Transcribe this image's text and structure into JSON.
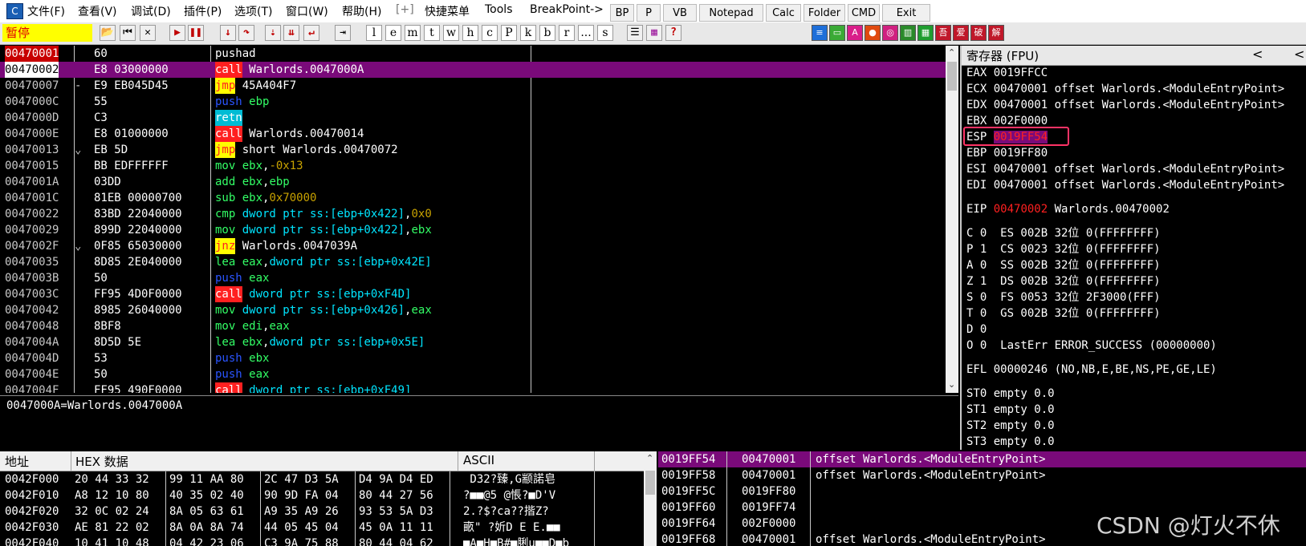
{
  "menu": {
    "app_icon": "C",
    "items": [
      "文件(F)",
      "查看(V)",
      "调试(D)",
      "插件(P)",
      "选项(T)",
      "窗口(W)",
      "帮助(H)",
      "[+]",
      "快捷菜单",
      "Tools",
      "BreakPoint->"
    ],
    "buttons": [
      "BP",
      "P",
      "VB",
      "Notepad",
      "Calc",
      "Folder",
      "CMD",
      "Exit"
    ]
  },
  "toolbar": {
    "state": "暂停",
    "letters": [
      "l",
      "e",
      "m",
      "t",
      "w",
      "h",
      "c",
      "P",
      "k",
      "b",
      "r",
      "...",
      "s"
    ],
    "colored_icons": [
      "≡",
      "▭",
      "A",
      "●",
      "◎",
      "▥",
      "▦",
      "吾",
      "爱",
      "破",
      "解"
    ]
  },
  "colors": {
    "accent_select": "#7a0a7a",
    "highlight_box": "#ff3366"
  },
  "disasm": {
    "rows": [
      {
        "addr": "00470001",
        "marker": "",
        "bytes": "60",
        "mn": "pushad",
        "mnc": "c-white",
        "mnbg": "",
        "ops": []
      },
      {
        "addr": "00470002",
        "marker": "",
        "bytes": "E8 03000000",
        "mn": "call",
        "mnc": "c-white",
        "mnbg": "#ff2020",
        "ops": [
          {
            "t": " Warlords.0047000A",
            "c": "c-white"
          }
        ]
      },
      {
        "addr": "00470007",
        "marker": "-",
        "bytes": "E9 EB045D45",
        "mn": "jmp",
        "mnc": "c-red",
        "mnbg": "#ffff00",
        "ops": [
          {
            "t": " 45A404F7",
            "c": "c-white"
          }
        ]
      },
      {
        "addr": "0047000C",
        "marker": "",
        "bytes": "55",
        "mn": "push",
        "mnc": "c-blue",
        "mnbg": "",
        "ops": [
          {
            "t": " ebp",
            "c": "c-green"
          }
        ]
      },
      {
        "addr": "0047000D",
        "marker": "",
        "bytes": "C3",
        "mn": "retn",
        "mnc": "c-white",
        "mnbg": "#00bcd4",
        "ops": []
      },
      {
        "addr": "0047000E",
        "marker": "",
        "bytes": "E8 01000000",
        "mn": "call",
        "mnc": "c-white",
        "mnbg": "#ff2020",
        "ops": [
          {
            "t": " Warlords.00470014",
            "c": "c-white"
          }
        ]
      },
      {
        "addr": "00470013",
        "marker": "⌄",
        "bytes": "EB 5D",
        "mn": "jmp",
        "mnc": "c-red",
        "mnbg": "#ffff00",
        "ops": [
          {
            "t": " short Warlords.00470072",
            "c": "c-white"
          }
        ]
      },
      {
        "addr": "00470015",
        "marker": "",
        "bytes": "BB EDFFFFFF",
        "mn": "mov",
        "mnc": "c-green",
        "mnbg": "",
        "ops": [
          {
            "t": " ebx",
            "c": "c-green"
          },
          {
            "t": ",",
            "c": "c-white"
          },
          {
            "t": "-0x13",
            "c": "c-olive"
          }
        ]
      },
      {
        "addr": "0047001A",
        "marker": "",
        "bytes": "03DD",
        "mn": "add",
        "mnc": "c-green",
        "mnbg": "",
        "ops": [
          {
            "t": " ebx",
            "c": "c-green"
          },
          {
            "t": ",",
            "c": "c-white"
          },
          {
            "t": "ebp",
            "c": "c-green"
          }
        ]
      },
      {
        "addr": "0047001C",
        "marker": "",
        "bytes": "81EB 00000700",
        "mn": "sub",
        "mnc": "c-green",
        "mnbg": "",
        "ops": [
          {
            "t": " ebx",
            "c": "c-green"
          },
          {
            "t": ",",
            "c": "c-white"
          },
          {
            "t": "0x70000",
            "c": "c-olive"
          }
        ]
      },
      {
        "addr": "00470022",
        "marker": "",
        "bytes": "83BD 22040000",
        "mn": "cmp",
        "mnc": "c-green",
        "mnbg": "",
        "ops": [
          {
            "t": " dword ptr ss:[ebp+0x422]",
            "c": "c-cyan"
          },
          {
            "t": ",",
            "c": "c-white"
          },
          {
            "t": "0x0",
            "c": "c-olive"
          }
        ]
      },
      {
        "addr": "00470029",
        "marker": "",
        "bytes": "899D 22040000",
        "mn": "mov",
        "mnc": "c-green",
        "mnbg": "",
        "ops": [
          {
            "t": " dword ptr ss:[ebp+0x422]",
            "c": "c-cyan"
          },
          {
            "t": ",",
            "c": "c-white"
          },
          {
            "t": "ebx",
            "c": "c-green"
          }
        ]
      },
      {
        "addr": "0047002F",
        "marker": "⌄",
        "bytes": "0F85 65030000",
        "mn": "jnz",
        "mnc": "c-red",
        "mnbg": "#ffff00",
        "ops": [
          {
            "t": " Warlords.0047039A",
            "c": "c-white"
          }
        ]
      },
      {
        "addr": "00470035",
        "marker": "",
        "bytes": "8D85 2E040000",
        "mn": "lea",
        "mnc": "c-green",
        "mnbg": "",
        "ops": [
          {
            "t": " eax",
            "c": "c-green"
          },
          {
            "t": ",",
            "c": "c-white"
          },
          {
            "t": "dword ptr ss:[ebp+0x42E]",
            "c": "c-cyan"
          }
        ]
      },
      {
        "addr": "0047003B",
        "marker": "",
        "bytes": "50",
        "mn": "push",
        "mnc": "c-blue",
        "mnbg": "",
        "ops": [
          {
            "t": " eax",
            "c": "c-green"
          }
        ]
      },
      {
        "addr": "0047003C",
        "marker": "",
        "bytes": "FF95 4D0F0000",
        "mn": "call",
        "mnc": "c-white",
        "mnbg": "#ff2020",
        "ops": [
          {
            "t": " dword ptr ss:[ebp+0xF4D]",
            "c": "c-cyan"
          }
        ]
      },
      {
        "addr": "00470042",
        "marker": "",
        "bytes": "8985 26040000",
        "mn": "mov",
        "mnc": "c-green",
        "mnbg": "",
        "ops": [
          {
            "t": " dword ptr ss:[ebp+0x426]",
            "c": "c-cyan"
          },
          {
            "t": ",",
            "c": "c-white"
          },
          {
            "t": "eax",
            "c": "c-green"
          }
        ]
      },
      {
        "addr": "00470048",
        "marker": "",
        "bytes": "8BF8",
        "mn": "mov",
        "mnc": "c-green",
        "mnbg": "",
        "ops": [
          {
            "t": " edi",
            "c": "c-green"
          },
          {
            "t": ",",
            "c": "c-white"
          },
          {
            "t": "eax",
            "c": "c-green"
          }
        ]
      },
      {
        "addr": "0047004A",
        "marker": "",
        "bytes": "8D5D 5E",
        "mn": "lea",
        "mnc": "c-green",
        "mnbg": "",
        "ops": [
          {
            "t": " ebx",
            "c": "c-green"
          },
          {
            "t": ",",
            "c": "c-white"
          },
          {
            "t": "dword ptr ss:[ebp+0x5E]",
            "c": "c-cyan"
          }
        ]
      },
      {
        "addr": "0047004D",
        "marker": "",
        "bytes": "53",
        "mn": "push",
        "mnc": "c-blue",
        "mnbg": "",
        "ops": [
          {
            "t": " ebx",
            "c": "c-green"
          }
        ]
      },
      {
        "addr": "0047004E",
        "marker": "",
        "bytes": "50",
        "mn": "push",
        "mnc": "c-blue",
        "mnbg": "",
        "ops": [
          {
            "t": " eax",
            "c": "c-green"
          }
        ]
      },
      {
        "addr": "0047004F",
        "marker": "",
        "bytes": "FF95 490F0000",
        "mn": "call",
        "mnc": "c-white",
        "mnbg": "#ff2020",
        "ops": [
          {
            "t": " dword ptr ss:[ebp+0xF49]",
            "c": "c-cyan"
          }
        ]
      }
    ]
  },
  "info": {
    "text": "0047000A=Warlords.0047000A"
  },
  "registers": {
    "title": "寄存器 (FPU)",
    "arrow": "<",
    "lines": [
      {
        "name": "EAX",
        "val": "0019FFCC",
        "rest": ""
      },
      {
        "name": "ECX",
        "val": "00470001",
        "rest": "offset Warlords.<ModuleEntryPoint>"
      },
      {
        "name": "EDX",
        "val": "00470001",
        "rest": "offset Warlords.<ModuleEntryPoint>"
      },
      {
        "name": "EBX",
        "val": "002F0000",
        "rest": ""
      },
      {
        "name": "ESP",
        "val": "0019FF54",
        "rest": ""
      },
      {
        "name": "EBP",
        "val": "0019FF80",
        "rest": ""
      },
      {
        "name": "ESI",
        "val": "00470001",
        "rest": "offset Warlords.<ModuleEntryPoint>"
      },
      {
        "name": "EDI",
        "val": "00470001",
        "rest": "offset Warlords.<ModuleEntryPoint>"
      },
      {
        "name": "EIP",
        "val": "00470002",
        "rest": "Warlords.00470002"
      }
    ],
    "flags": [
      "C 0  ES 002B 32位 0(FFFFFFFF)",
      "P 1  CS 0023 32位 0(FFFFFFFF)",
      "A 0  SS 002B 32位 0(FFFFFFFF)",
      "Z 1  DS 002B 32位 0(FFFFFFFF)",
      "S 0  FS 0053 32位 2F3000(FFF)",
      "T 0  GS 002B 32位 0(FFFFFFFF)",
      "D 0",
      "O 0  LastErr ERROR_SUCCESS (00000000)"
    ],
    "efl": "EFL 00000246 (NO,NB,E,BE,NS,PE,GE,LE)",
    "fpu": [
      "ST0 empty 0.0",
      "ST1 empty 0.0",
      "ST2 empty 0.0",
      "ST3 empty 0.0"
    ]
  },
  "dump": {
    "headers": [
      "地址",
      "HEX 数据",
      "ASCII"
    ],
    "rows": [
      {
        "addr": "0042F000",
        "hex": [
          "20 44 33 32",
          "99 11 AA 80",
          "2C 47 D3 5A",
          "D4 9A D4 ED"
        ],
        "ascii": " D32?臻,G颛諾皂"
      },
      {
        "addr": "0042F010",
        "hex": [
          "A8 12 10 80",
          "40 35 02 40",
          "90 9D FA 04",
          "80 44 27 56"
        ],
        "ascii": "?■■@5 @悵?■D'V"
      },
      {
        "addr": "0042F020",
        "hex": [
          "32 0C 02 24",
          "8A 05 63 61",
          "A9 35 A9 26",
          "93 53 5A D3"
        ],
        "ascii": "2.?$?ca??揩Z?"
      },
      {
        "addr": "0042F030",
        "hex": [
          "AE 81 22 02",
          "8A 0A 8A 74",
          "44 05 45 04",
          "45 0A 11 11"
        ],
        "ascii": "畞\" ?妡D E E.■■"
      },
      {
        "addr": "0042F040",
        "hex": [
          "10 41 10 48",
          "04 42 23 06",
          "C3 9A 75 88",
          "80 44 04 62"
        ],
        "ascii": "■A■H■B#■脷u■■D■b"
      }
    ]
  },
  "stack": {
    "rows": [
      {
        "addr": "0019FF54",
        "val": "00470001",
        "comment": "offset Warlords.<ModuleEntryPoint>"
      },
      {
        "addr": "0019FF58",
        "val": "00470001",
        "comment": "offset Warlords.<ModuleEntryPoint>"
      },
      {
        "addr": "0019FF5C",
        "val": "0019FF80",
        "comment": ""
      },
      {
        "addr": "0019FF60",
        "val": "0019FF74",
        "comment": ""
      },
      {
        "addr": "0019FF64",
        "val": "002F0000",
        "comment": ""
      },
      {
        "addr": "0019FF68",
        "val": "00470001",
        "comment": "offset Warlords.<ModuleEntryPoint>"
      }
    ]
  },
  "watermark": "CSDN @灯火不休"
}
